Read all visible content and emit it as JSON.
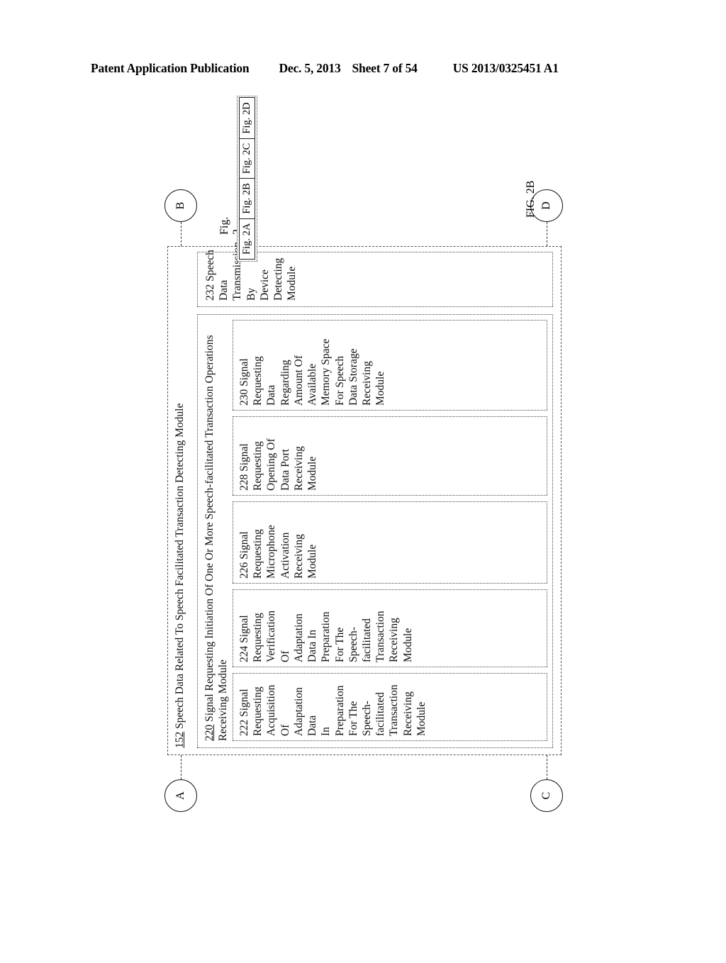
{
  "header": {
    "publication": "Patent Application Publication",
    "date": "Dec. 5, 2013",
    "sheet": "Sheet 7 of 54",
    "patent_number": "US 2013/0325451 A1"
  },
  "figure": {
    "caption": "FIG. 2B",
    "connectors": {
      "top_left": "C",
      "top_right": "D",
      "bottom_left": "A",
      "bottom_right": "B"
    },
    "outer_module": {
      "ref": "152",
      "label": "152 Speech Data Related To Speech Facilitated Transaction Detecting Module"
    },
    "inner_module": {
      "ref": "220",
      "label": "220 Signal Requesting Initiation Of One Or More Speech-facilitated Transaction Operations Receiving Module"
    },
    "boxes": [
      {
        "ref": "222",
        "lines": [
          "222 Signal",
          "Requesting",
          "Acquisition Of",
          "Adaptation Data",
          "In Preparation",
          "For The Speech-",
          "facilitated",
          "Transaction",
          "Receiving",
          "Module"
        ]
      },
      {
        "ref": "224",
        "lines": [
          "224 Signal",
          "Requesting",
          "Verification",
          "Of",
          "Adaptation",
          "Data In",
          "Preparation",
          "For The",
          "Speech-",
          "facilitated",
          "Transaction",
          "Receiving",
          "Module"
        ]
      },
      {
        "ref": "226",
        "lines": [
          "226 Signal",
          "Requesting",
          "Microphone",
          "Activation",
          "Receiving",
          "Module"
        ]
      },
      {
        "ref": "228",
        "lines": [
          "228 Signal",
          "Requesting",
          "Opening Of",
          "Data Port",
          "Receiving",
          "Module"
        ]
      },
      {
        "ref": "230",
        "lines": [
          "230 Signal",
          "Requesting",
          "Data",
          "Regarding",
          "Amount Of",
          "Available",
          "Memory Space",
          "For Speech",
          "Data Storage",
          "Receiving",
          "Module"
        ]
      },
      {
        "ref": "232",
        "lines": [
          "232 Speech Data",
          "Transmission By",
          "Device Detecting",
          "Module"
        ]
      }
    ],
    "figure_key": {
      "caption": "Fig. 2",
      "cells": [
        "Fig. 2A",
        "Fig. 2B",
        "Fig. 2C",
        "Fig. 2D"
      ]
    }
  }
}
